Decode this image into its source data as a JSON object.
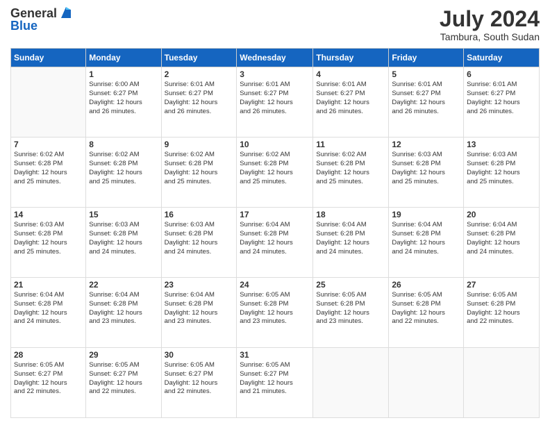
{
  "header": {
    "logo": {
      "line1": "General",
      "line2": "Blue"
    },
    "title": "July 2024",
    "location": "Tambura, South Sudan"
  },
  "days_of_week": [
    "Sunday",
    "Monday",
    "Tuesday",
    "Wednesday",
    "Thursday",
    "Friday",
    "Saturday"
  ],
  "weeks": [
    [
      {
        "day": "",
        "info": ""
      },
      {
        "day": "1",
        "info": "Sunrise: 6:00 AM\nSunset: 6:27 PM\nDaylight: 12 hours\nand 26 minutes."
      },
      {
        "day": "2",
        "info": "Sunrise: 6:01 AM\nSunset: 6:27 PM\nDaylight: 12 hours\nand 26 minutes."
      },
      {
        "day": "3",
        "info": "Sunrise: 6:01 AM\nSunset: 6:27 PM\nDaylight: 12 hours\nand 26 minutes."
      },
      {
        "day": "4",
        "info": "Sunrise: 6:01 AM\nSunset: 6:27 PM\nDaylight: 12 hours\nand 26 minutes."
      },
      {
        "day": "5",
        "info": "Sunrise: 6:01 AM\nSunset: 6:27 PM\nDaylight: 12 hours\nand 26 minutes."
      },
      {
        "day": "6",
        "info": "Sunrise: 6:01 AM\nSunset: 6:27 PM\nDaylight: 12 hours\nand 26 minutes."
      }
    ],
    [
      {
        "day": "7",
        "info": ""
      },
      {
        "day": "8",
        "info": "Sunrise: 6:02 AM\nSunset: 6:28 PM\nDaylight: 12 hours\nand 25 minutes."
      },
      {
        "day": "9",
        "info": "Sunrise: 6:02 AM\nSunset: 6:28 PM\nDaylight: 12 hours\nand 25 minutes."
      },
      {
        "day": "10",
        "info": "Sunrise: 6:02 AM\nSunset: 6:28 PM\nDaylight: 12 hours\nand 25 minutes."
      },
      {
        "day": "11",
        "info": "Sunrise: 6:02 AM\nSunset: 6:28 PM\nDaylight: 12 hours\nand 25 minutes."
      },
      {
        "day": "12",
        "info": "Sunrise: 6:03 AM\nSunset: 6:28 PM\nDaylight: 12 hours\nand 25 minutes."
      },
      {
        "day": "13",
        "info": "Sunrise: 6:03 AM\nSunset: 6:28 PM\nDaylight: 12 hours\nand 25 minutes."
      }
    ],
    [
      {
        "day": "14",
        "info": ""
      },
      {
        "day": "15",
        "info": "Sunrise: 6:03 AM\nSunset: 6:28 PM\nDaylight: 12 hours\nand 24 minutes."
      },
      {
        "day": "16",
        "info": "Sunrise: 6:03 AM\nSunset: 6:28 PM\nDaylight: 12 hours\nand 24 minutes."
      },
      {
        "day": "17",
        "info": "Sunrise: 6:04 AM\nSunset: 6:28 PM\nDaylight: 12 hours\nand 24 minutes."
      },
      {
        "day": "18",
        "info": "Sunrise: 6:04 AM\nSunset: 6:28 PM\nDaylight: 12 hours\nand 24 minutes."
      },
      {
        "day": "19",
        "info": "Sunrise: 6:04 AM\nSunset: 6:28 PM\nDaylight: 12 hours\nand 24 minutes."
      },
      {
        "day": "20",
        "info": "Sunrise: 6:04 AM\nSunset: 6:28 PM\nDaylight: 12 hours\nand 24 minutes."
      }
    ],
    [
      {
        "day": "21",
        "info": ""
      },
      {
        "day": "22",
        "info": "Sunrise: 6:04 AM\nSunset: 6:28 PM\nDaylight: 12 hours\nand 23 minutes."
      },
      {
        "day": "23",
        "info": "Sunrise: 6:04 AM\nSunset: 6:28 PM\nDaylight: 12 hours\nand 23 minutes."
      },
      {
        "day": "24",
        "info": "Sunrise: 6:05 AM\nSunset: 6:28 PM\nDaylight: 12 hours\nand 23 minutes."
      },
      {
        "day": "25",
        "info": "Sunrise: 6:05 AM\nSunset: 6:28 PM\nDaylight: 12 hours\nand 23 minutes."
      },
      {
        "day": "26",
        "info": "Sunrise: 6:05 AM\nSunset: 6:28 PM\nDaylight: 12 hours\nand 22 minutes."
      },
      {
        "day": "27",
        "info": "Sunrise: 6:05 AM\nSunset: 6:28 PM\nDaylight: 12 hours\nand 22 minutes."
      }
    ],
    [
      {
        "day": "28",
        "info": "Sunrise: 6:05 AM\nSunset: 6:27 PM\nDaylight: 12 hours\nand 22 minutes."
      },
      {
        "day": "29",
        "info": "Sunrise: 6:05 AM\nSunset: 6:27 PM\nDaylight: 12 hours\nand 22 minutes."
      },
      {
        "day": "30",
        "info": "Sunrise: 6:05 AM\nSunset: 6:27 PM\nDaylight: 12 hours\nand 22 minutes."
      },
      {
        "day": "31",
        "info": "Sunrise: 6:05 AM\nSunset: 6:27 PM\nDaylight: 12 hours\nand 21 minutes."
      },
      {
        "day": "",
        "info": ""
      },
      {
        "day": "",
        "info": ""
      },
      {
        "day": "",
        "info": ""
      }
    ]
  ],
  "week1_sunday_info": "Sunrise: 6:02 AM\nSunset: 6:28 PM\nDaylight: 12 hours\nand 25 minutes.",
  "week3_sunday_info": "Sunrise: 6:03 AM\nSunset: 6:28 PM\nDaylight: 12 hours\nand 25 minutes.",
  "week4_sunday_info": "Sunrise: 6:04 AM\nSunset: 6:28 PM\nDaylight: 12 hours\nand 24 minutes."
}
